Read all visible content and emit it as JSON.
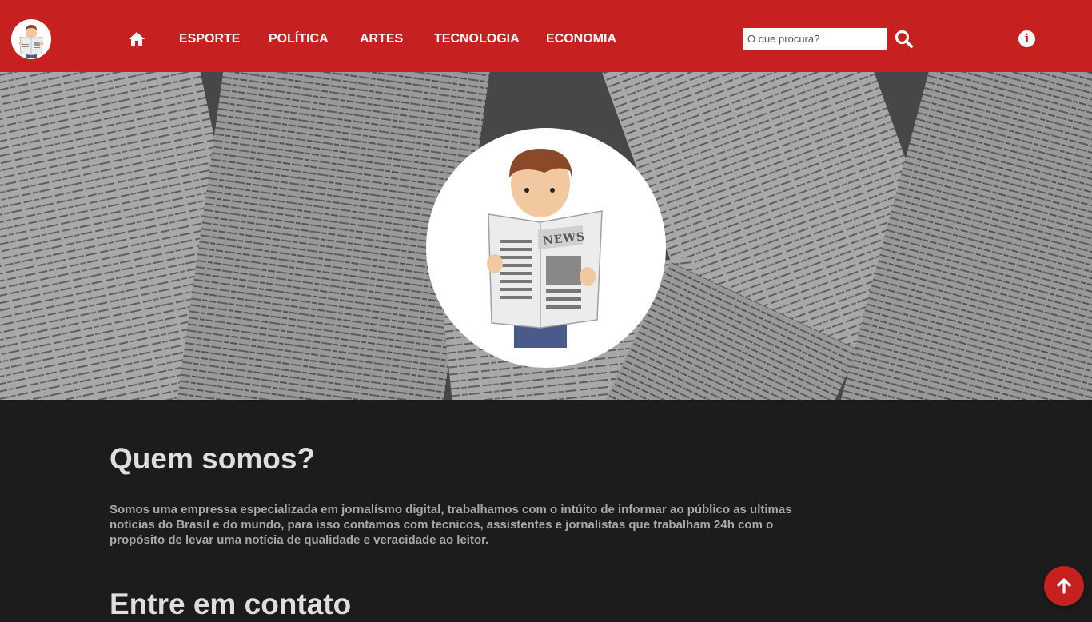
{
  "navbar": {
    "links": [
      {
        "label": "ESPORTE"
      },
      {
        "label": "POLÍTICA"
      },
      {
        "label": "ARTES"
      },
      {
        "label": "TECNOLOGIA"
      },
      {
        "label": "ECONOMIA"
      }
    ],
    "search": {
      "placeholder": "O que procura?",
      "value": ""
    },
    "info_label": "i",
    "icons": {
      "home": "home-icon",
      "search": "search-icon",
      "info": "info-icon"
    }
  },
  "hero": {
    "avatar_label": "NEWS"
  },
  "about": {
    "title": "Quem somos?",
    "text": "Somos uma empressa especializada em jornalísmo digital, trabalhamos com o intúito de informar ao público as ultimas notícias do Brasil e do mundo, para isso contamos com tecnicos, assistentes e jornalistas que trabalham 24h com o propósito de levar uma notícia de qualidade e veracidade ao leitor."
  },
  "contact": {
    "title": "Entre em contato"
  },
  "colors": {
    "brand_red": "#c62020",
    "content_bg": "#1c1c1c"
  }
}
